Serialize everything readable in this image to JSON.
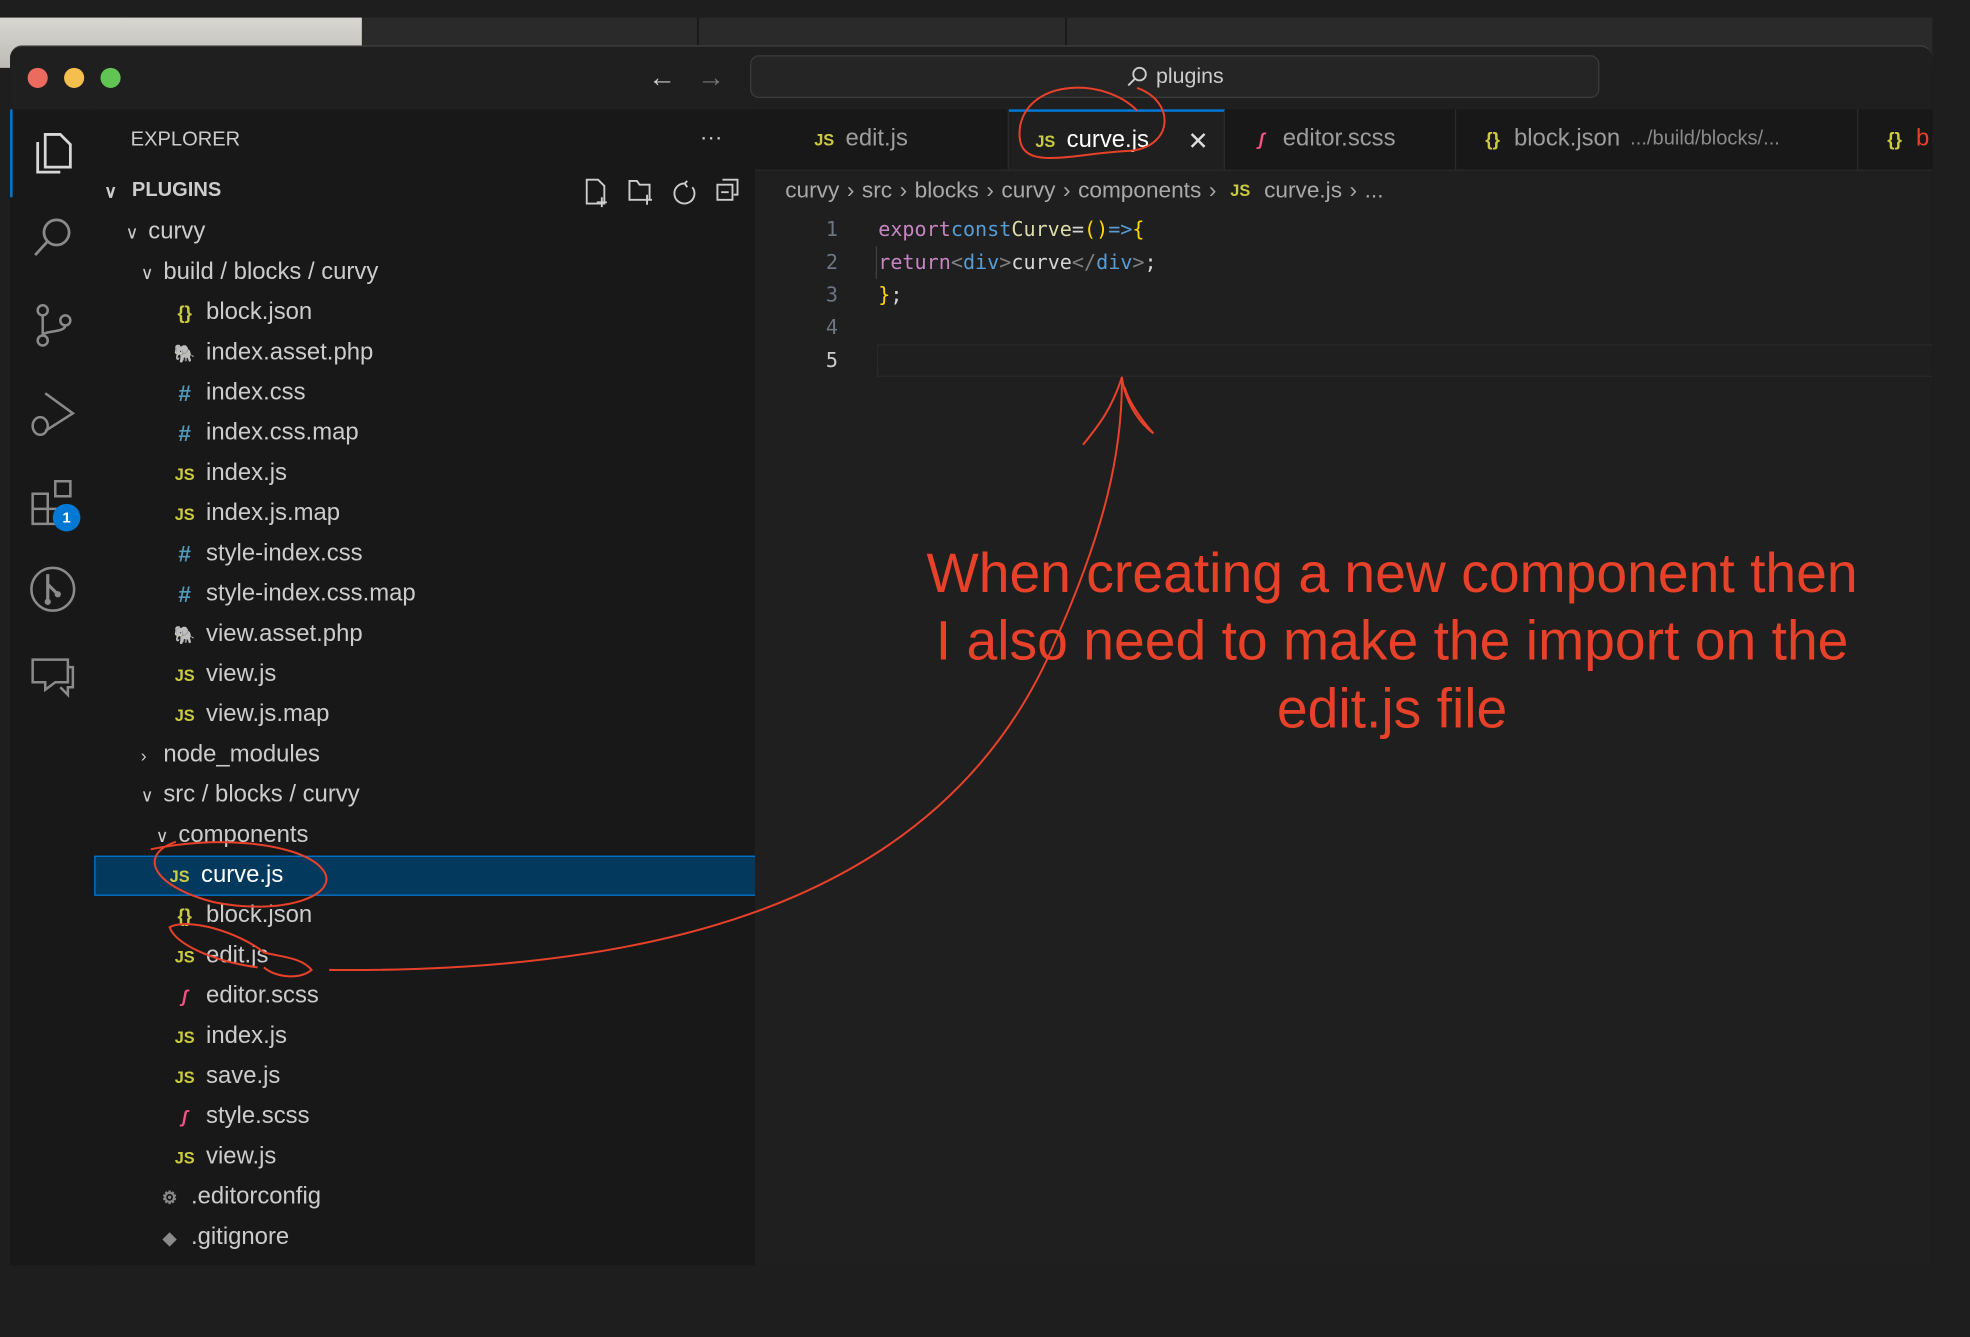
{
  "window": {
    "search": "plugins"
  },
  "activity": {
    "items": [
      "explorer",
      "search",
      "source-control",
      "run-debug",
      "extensions",
      "git-graph",
      "chat"
    ],
    "extensions_badge": "1"
  },
  "sidebar": {
    "title": "EXPLORER",
    "more": "···",
    "section": "PLUGINS",
    "tree": [
      {
        "label": "curvy",
        "type": "folder",
        "open": true,
        "depth": 0
      },
      {
        "label": "build / blocks / curvy",
        "type": "folder",
        "open": true,
        "depth": 1
      },
      {
        "label": "block.json",
        "type": "json",
        "depth": 2
      },
      {
        "label": "index.asset.php",
        "type": "php",
        "depth": 2
      },
      {
        "label": "index.css",
        "type": "css",
        "depth": 2
      },
      {
        "label": "index.css.map",
        "type": "css",
        "depth": 2
      },
      {
        "label": "index.js",
        "type": "js",
        "depth": 2
      },
      {
        "label": "index.js.map",
        "type": "js",
        "depth": 2
      },
      {
        "label": "style-index.css",
        "type": "css",
        "depth": 2
      },
      {
        "label": "style-index.css.map",
        "type": "css",
        "depth": 2
      },
      {
        "label": "view.asset.php",
        "type": "php",
        "depth": 2
      },
      {
        "label": "view.js",
        "type": "js",
        "depth": 2
      },
      {
        "label": "view.js.map",
        "type": "js",
        "depth": 2
      },
      {
        "label": "node_modules",
        "type": "folder",
        "open": false,
        "depth": 1
      },
      {
        "label": "src / blocks / curvy",
        "type": "folder",
        "open": true,
        "depth": 1
      },
      {
        "label": "components",
        "type": "folder",
        "open": true,
        "depth": 2
      },
      {
        "label": "curve.js",
        "type": "js",
        "depth": 3,
        "selected": true
      },
      {
        "label": "block.json",
        "type": "json",
        "depth": 2
      },
      {
        "label": "edit.js",
        "type": "js",
        "depth": 2
      },
      {
        "label": "editor.scss",
        "type": "scss",
        "depth": 2
      },
      {
        "label": "index.js",
        "type": "js",
        "depth": 2
      },
      {
        "label": "save.js",
        "type": "js",
        "depth": 2
      },
      {
        "label": "style.scss",
        "type": "scss",
        "depth": 2
      },
      {
        "label": "view.js",
        "type": "js",
        "depth": 2
      },
      {
        "label": ".editorconfig",
        "type": "config",
        "depth": 1
      },
      {
        "label": ".gitignore",
        "type": "git",
        "depth": 1
      }
    ]
  },
  "editor": {
    "tabs": [
      {
        "label": "edit.js",
        "type": "js"
      },
      {
        "label": "curve.js",
        "type": "js",
        "active": true
      },
      {
        "label": "editor.scss",
        "type": "scss"
      },
      {
        "label": "block.json",
        "type": "json",
        "desc": ".../build/blocks/..."
      },
      {
        "label": "b",
        "type": "json"
      }
    ],
    "breadcrumb": [
      "curvy",
      "src",
      "blocks",
      "curvy",
      "components",
      "curve.js",
      "..."
    ],
    "lines": [
      "1",
      "2",
      "3",
      "4",
      "5"
    ],
    "code": {
      "l1": [
        "export",
        "const",
        "Curve",
        "=",
        "()",
        "=>",
        "{"
      ],
      "l2": [
        "return",
        "<",
        "div",
        ">",
        "curve",
        "</",
        "div",
        ">",
        ";"
      ],
      "l3": [
        "}",
        ";"
      ]
    }
  },
  "annotation": {
    "lines": [
      "When creating a new component then",
      "I also need to make the import on the",
      "edit.js file"
    ],
    "color": "#e8412a"
  }
}
